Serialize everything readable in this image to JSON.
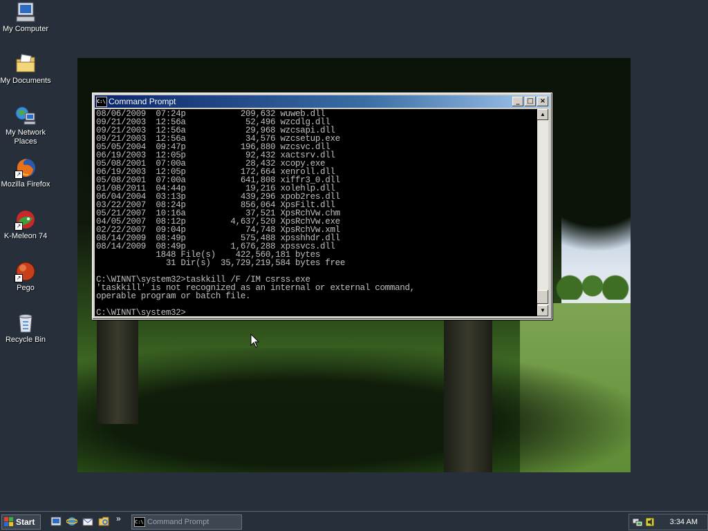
{
  "desktop_icons": [
    {
      "label": "My Computer",
      "icon": "my-computer-icon"
    },
    {
      "label": "My Documents",
      "icon": "my-documents-icon"
    },
    {
      "label": "My Network Places",
      "icon": "network-places-icon"
    },
    {
      "label": "Mozilla Firefox",
      "icon": "firefox-icon"
    },
    {
      "label": "K-Meleon 74",
      "icon": "k-meleon-icon"
    },
    {
      "label": "Pego",
      "icon": "pego-icon"
    },
    {
      "label": "Recycle Bin",
      "icon": "recycle-bin-icon"
    }
  ],
  "cmd_window": {
    "title": "Command Prompt",
    "title_icon_text": "C:\\",
    "console_lines": [
      "08/06/2009  07:24p           209,632 wuweb.dll",
      "09/21/2003  12:56a            52,496 wzcdlg.dll",
      "09/21/2003  12:56a            29,968 wzcsapi.dll",
      "09/21/2003  12:56a            34,576 wzcsetup.exe",
      "05/05/2004  09:47p           196,880 wzcsvc.dll",
      "06/19/2003  12:05p            92,432 xactsrv.dll",
      "05/08/2001  07:00a            28,432 xcopy.exe",
      "06/19/2003  12:05p           172,664 xenroll.dll",
      "05/08/2001  07:00a           641,808 xiffr3_0.dll",
      "01/08/2011  04:44p            19,216 xolehlp.dll",
      "06/04/2004  03:13p           439,296 xpob2res.dll",
      "03/22/2007  08:24p           856,064 XpsFilt.dll",
      "05/21/2007  10:16a            37,521 XpsRchVw.chm",
      "04/05/2007  08:12p         4,637,520 XpsRchVw.exe",
      "02/22/2007  09:04p            74,748 XpsRchVw.xml",
      "08/14/2009  08:49p           575,488 xpsshhdr.dll",
      "08/14/2009  08:49p         1,676,288 xpssvcs.dll",
      "            1848 File(s)    422,560,181 bytes",
      "              31 Dir(s)  35,729,219,584 bytes free",
      "",
      "C:\\WINNT\\system32>taskkill /F /IM csrss.exe",
      "'taskkill' is not recognized as an internal or external command,",
      "operable program or batch file.",
      "",
      "C:\\WINNT\\system32>"
    ],
    "buttons": {
      "minimize": "_",
      "maximize": "□",
      "close": "×"
    }
  },
  "taskbar": {
    "start_label": "Start",
    "quick_launch": [
      "show-desktop-icon",
      "ie-icon",
      "outlook-express-icon",
      "explorer-icon"
    ],
    "overflow_chevron": "»",
    "task_buttons": [
      {
        "label": "Command Prompt",
        "icon": "cmd-icon"
      }
    ],
    "tray_icons": [
      "network-tray-icon",
      "volume-tray-icon"
    ],
    "clock": "3:34 AM"
  }
}
